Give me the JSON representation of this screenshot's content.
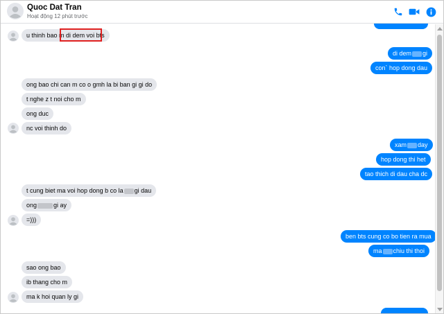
{
  "header": {
    "contact_name": "Quoc Dat Tran",
    "status": "Hoạt động 12 phút trước",
    "icons": [
      "phone-icon",
      "video-camera-icon",
      "info-icon"
    ],
    "accent_color": "#0084ff"
  },
  "messages": [
    {
      "dir": "out",
      "text": "",
      "partial": "top"
    },
    {
      "dir": "in",
      "pre": "u thinh bao m ",
      "highlight": "di dem voi bts"
    },
    {
      "dir": "out",
      "pre": "di dem",
      "blurred": true,
      "post": "gi"
    },
    {
      "dir": "out",
      "text": "con` hop dong dau"
    },
    {
      "dir": "in",
      "text": "ong bao chi can m co o gmh la bi ban gi gi do"
    },
    {
      "dir": "in",
      "text": "t nghe z t noi cho m"
    },
    {
      "dir": "in",
      "text": "ong duc"
    },
    {
      "dir": "in",
      "text": "nc voi thinh do"
    },
    {
      "dir": "out",
      "pre": "xam",
      "blurred": true,
      "post": "day"
    },
    {
      "dir": "out",
      "text": "hop dong thi het"
    },
    {
      "dir": "out",
      "text": "tao thich di dau cha dc"
    },
    {
      "dir": "in",
      "pre": "t cung biet ma voi hop dong b co la",
      "blurred": true,
      "post": "gi dau"
    },
    {
      "dir": "in",
      "pre": "ong",
      "blurred": true,
      "post": "gi ay"
    },
    {
      "dir": "in",
      "text": "=)))"
    },
    {
      "dir": "out",
      "text": "ben bts cung co bo tien ra mua"
    },
    {
      "dir": "out",
      "pre": "ma",
      "blurred": true,
      "post": "chiu thi thoi"
    },
    {
      "dir": "in",
      "text": "sao ong bao"
    },
    {
      "dir": "in",
      "text": "ib thang cho m"
    },
    {
      "dir": "in",
      "text": "ma k hoi quan ly gi"
    },
    {
      "dir": "out",
      "text": "",
      "partial": "bottom"
    }
  ],
  "highlight_color": "#e02020"
}
